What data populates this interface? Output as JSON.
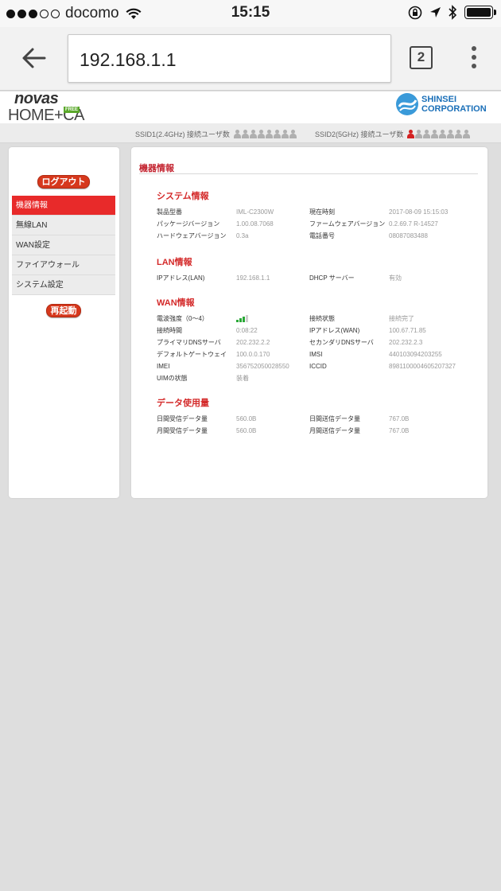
{
  "status_bar": {
    "carrier": "docomo",
    "time": "15:15",
    "signal_dots_filled": 3,
    "signal_dots_total": 5
  },
  "browser": {
    "url": "192.168.1.1",
    "tab_count": "2"
  },
  "header": {
    "brand_line1": "novas",
    "brand_line2": "HOME+CA",
    "brand_badge": "FREE",
    "corp_line1": "SHINSEI",
    "corp_line2": "CORPORATION"
  },
  "ssid": {
    "ssid1_label": "SSID1(2.4GHz) 接続ユーザ数",
    "ssid1_connected": 0,
    "ssid1_total": 8,
    "ssid2_label": "SSID2(5GHz) 接続ユーザ数",
    "ssid2_connected": 1,
    "ssid2_total": 8
  },
  "sidebar": {
    "logout_label": "ログアウト",
    "reboot_label": "再起動",
    "items": [
      {
        "label": "機器情報"
      },
      {
        "label": "無線LAN"
      },
      {
        "label": "WAN設定"
      },
      {
        "label": "ファイアウォール"
      },
      {
        "label": "システム設定"
      }
    ]
  },
  "main": {
    "title": "機器情報",
    "system": {
      "title": "システム情報",
      "rows": [
        [
          "製品型番",
          "IML-C2300W",
          "現在時刻",
          "2017-08-09 15:15:03"
        ],
        [
          "パッケージバージョン",
          "1.00.08.7068",
          "ファームウェアバージョン",
          "0.2.69.7 R-14527"
        ],
        [
          "ハードウェアバージョン",
          "0.3a",
          "電話番号",
          "08087083488"
        ]
      ]
    },
    "lan": {
      "title": "LAN情報",
      "rows": [
        [
          "IPアドレス(LAN)",
          "192.168.1.1",
          "DHCP サーバー",
          "有効"
        ]
      ]
    },
    "wan": {
      "title": "WAN情報",
      "signal_label": "電波強度（0〜4）",
      "signal_level": 3,
      "signal_max": 4,
      "status_label": "接続状態",
      "status_value": "接続完了",
      "rows": [
        [
          "接続時間",
          "0:08:22",
          "IPアドレス(WAN)",
          "100.67.71.85"
        ],
        [
          "プライマリDNSサーバ",
          "202.232.2.2",
          "セカンダリDNSサーバ",
          "202.232.2.3"
        ],
        [
          "デフォルトゲートウェイ",
          "100.0.0.170",
          "IMSI",
          "440103094203255"
        ],
        [
          "IMEI",
          "356752050028550",
          "ICCID",
          "8981100004605207327"
        ]
      ],
      "uim_label": "UIMの状態",
      "uim_value": "装着"
    },
    "data_usage": {
      "title": "データ使用量",
      "rows": [
        [
          "日間受信データ量",
          "560.0B",
          "日間送信データ量",
          "767.0B"
        ],
        [
          "月間受信データ量",
          "560.0B",
          "月間送信データ量",
          "767.0B"
        ]
      ]
    }
  }
}
